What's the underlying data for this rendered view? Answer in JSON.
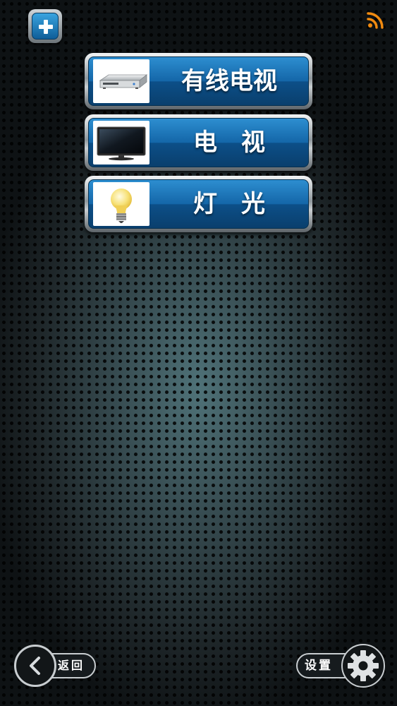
{
  "header": {
    "add_icon": "plus-icon",
    "signal_icon": "rss-signal-icon"
  },
  "menu": [
    {
      "label": "有线电视",
      "icon": "set-top-box-icon"
    },
    {
      "label": "电　视",
      "icon": "tv-icon"
    },
    {
      "label": "灯　光",
      "icon": "light-bulb-icon"
    }
  ],
  "footer": {
    "back_label": "返回",
    "back_icon": "chevron-left-icon",
    "settings_label": "设置",
    "settings_icon": "gear-icon"
  },
  "colors": {
    "button_blue": "#1466a8",
    "chrome": "#c8cdd0",
    "signal_orange": "#f08a10"
  }
}
